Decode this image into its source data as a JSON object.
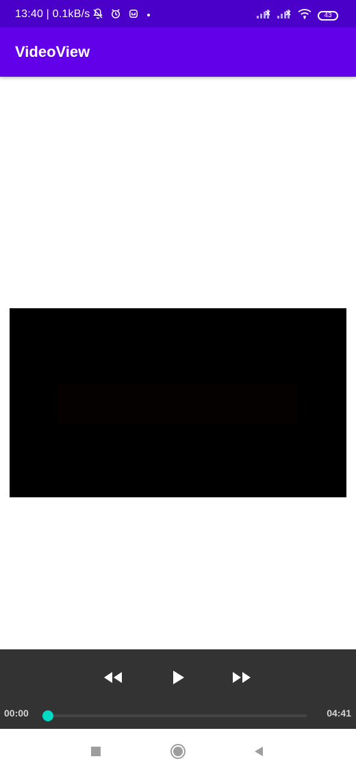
{
  "status_bar": {
    "text": "13:40 | 0.1kB/s",
    "battery": "43",
    "icons": [
      "notifications-off-icon",
      "alarm-icon",
      "app-icon",
      "dot-icon",
      "signal-icon",
      "signal-icon",
      "wifi-icon",
      "battery-icon"
    ]
  },
  "app_bar": {
    "title": "VideoView",
    "color": "#6200ea"
  },
  "video": {
    "background": "#000000"
  },
  "media_controller": {
    "buttons": [
      "rewind-icon",
      "play-icon",
      "fast-forward-icon"
    ],
    "current_time": "00:00",
    "total_time": "04:41",
    "progress": 0,
    "accent_color": "#03dac5"
  },
  "navigation_bar": {
    "buttons": [
      "recents-icon",
      "home-icon",
      "back-icon"
    ]
  }
}
